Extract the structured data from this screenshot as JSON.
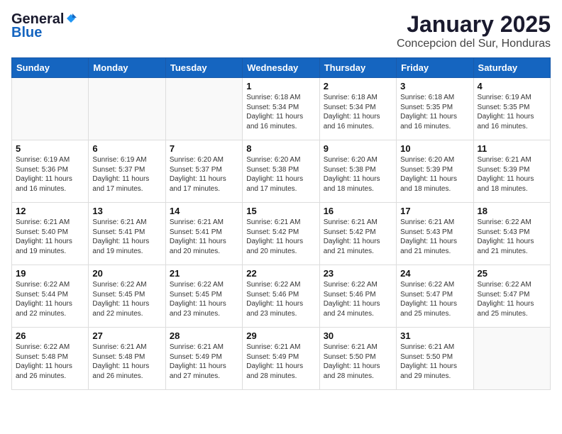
{
  "header": {
    "logo_general": "General",
    "logo_blue": "Blue",
    "title": "January 2025",
    "subtitle": "Concepcion del Sur, Honduras"
  },
  "weekdays": [
    "Sunday",
    "Monday",
    "Tuesday",
    "Wednesday",
    "Thursday",
    "Friday",
    "Saturday"
  ],
  "weeks": [
    [
      {
        "day": "",
        "sunrise": "",
        "sunset": "",
        "daylight": ""
      },
      {
        "day": "",
        "sunrise": "",
        "sunset": "",
        "daylight": ""
      },
      {
        "day": "",
        "sunrise": "",
        "sunset": "",
        "daylight": ""
      },
      {
        "day": "1",
        "sunrise": "Sunrise: 6:18 AM",
        "sunset": "Sunset: 5:34 PM",
        "daylight": "Daylight: 11 hours and 16 minutes."
      },
      {
        "day": "2",
        "sunrise": "Sunrise: 6:18 AM",
        "sunset": "Sunset: 5:34 PM",
        "daylight": "Daylight: 11 hours and 16 minutes."
      },
      {
        "day": "3",
        "sunrise": "Sunrise: 6:18 AM",
        "sunset": "Sunset: 5:35 PM",
        "daylight": "Daylight: 11 hours and 16 minutes."
      },
      {
        "day": "4",
        "sunrise": "Sunrise: 6:19 AM",
        "sunset": "Sunset: 5:35 PM",
        "daylight": "Daylight: 11 hours and 16 minutes."
      }
    ],
    [
      {
        "day": "5",
        "sunrise": "Sunrise: 6:19 AM",
        "sunset": "Sunset: 5:36 PM",
        "daylight": "Daylight: 11 hours and 16 minutes."
      },
      {
        "day": "6",
        "sunrise": "Sunrise: 6:19 AM",
        "sunset": "Sunset: 5:37 PM",
        "daylight": "Daylight: 11 hours and 17 minutes."
      },
      {
        "day": "7",
        "sunrise": "Sunrise: 6:20 AM",
        "sunset": "Sunset: 5:37 PM",
        "daylight": "Daylight: 11 hours and 17 minutes."
      },
      {
        "day": "8",
        "sunrise": "Sunrise: 6:20 AM",
        "sunset": "Sunset: 5:38 PM",
        "daylight": "Daylight: 11 hours and 17 minutes."
      },
      {
        "day": "9",
        "sunrise": "Sunrise: 6:20 AM",
        "sunset": "Sunset: 5:38 PM",
        "daylight": "Daylight: 11 hours and 18 minutes."
      },
      {
        "day": "10",
        "sunrise": "Sunrise: 6:20 AM",
        "sunset": "Sunset: 5:39 PM",
        "daylight": "Daylight: 11 hours and 18 minutes."
      },
      {
        "day": "11",
        "sunrise": "Sunrise: 6:21 AM",
        "sunset": "Sunset: 5:39 PM",
        "daylight": "Daylight: 11 hours and 18 minutes."
      }
    ],
    [
      {
        "day": "12",
        "sunrise": "Sunrise: 6:21 AM",
        "sunset": "Sunset: 5:40 PM",
        "daylight": "Daylight: 11 hours and 19 minutes."
      },
      {
        "day": "13",
        "sunrise": "Sunrise: 6:21 AM",
        "sunset": "Sunset: 5:41 PM",
        "daylight": "Daylight: 11 hours and 19 minutes."
      },
      {
        "day": "14",
        "sunrise": "Sunrise: 6:21 AM",
        "sunset": "Sunset: 5:41 PM",
        "daylight": "Daylight: 11 hours and 20 minutes."
      },
      {
        "day": "15",
        "sunrise": "Sunrise: 6:21 AM",
        "sunset": "Sunset: 5:42 PM",
        "daylight": "Daylight: 11 hours and 20 minutes."
      },
      {
        "day": "16",
        "sunrise": "Sunrise: 6:21 AM",
        "sunset": "Sunset: 5:42 PM",
        "daylight": "Daylight: 11 hours and 21 minutes."
      },
      {
        "day": "17",
        "sunrise": "Sunrise: 6:21 AM",
        "sunset": "Sunset: 5:43 PM",
        "daylight": "Daylight: 11 hours and 21 minutes."
      },
      {
        "day": "18",
        "sunrise": "Sunrise: 6:22 AM",
        "sunset": "Sunset: 5:43 PM",
        "daylight": "Daylight: 11 hours and 21 minutes."
      }
    ],
    [
      {
        "day": "19",
        "sunrise": "Sunrise: 6:22 AM",
        "sunset": "Sunset: 5:44 PM",
        "daylight": "Daylight: 11 hours and 22 minutes."
      },
      {
        "day": "20",
        "sunrise": "Sunrise: 6:22 AM",
        "sunset": "Sunset: 5:45 PM",
        "daylight": "Daylight: 11 hours and 22 minutes."
      },
      {
        "day": "21",
        "sunrise": "Sunrise: 6:22 AM",
        "sunset": "Sunset: 5:45 PM",
        "daylight": "Daylight: 11 hours and 23 minutes."
      },
      {
        "day": "22",
        "sunrise": "Sunrise: 6:22 AM",
        "sunset": "Sunset: 5:46 PM",
        "daylight": "Daylight: 11 hours and 23 minutes."
      },
      {
        "day": "23",
        "sunrise": "Sunrise: 6:22 AM",
        "sunset": "Sunset: 5:46 PM",
        "daylight": "Daylight: 11 hours and 24 minutes."
      },
      {
        "day": "24",
        "sunrise": "Sunrise: 6:22 AM",
        "sunset": "Sunset: 5:47 PM",
        "daylight": "Daylight: 11 hours and 25 minutes."
      },
      {
        "day": "25",
        "sunrise": "Sunrise: 6:22 AM",
        "sunset": "Sunset: 5:47 PM",
        "daylight": "Daylight: 11 hours and 25 minutes."
      }
    ],
    [
      {
        "day": "26",
        "sunrise": "Sunrise: 6:22 AM",
        "sunset": "Sunset: 5:48 PM",
        "daylight": "Daylight: 11 hours and 26 minutes."
      },
      {
        "day": "27",
        "sunrise": "Sunrise: 6:21 AM",
        "sunset": "Sunset: 5:48 PM",
        "daylight": "Daylight: 11 hours and 26 minutes."
      },
      {
        "day": "28",
        "sunrise": "Sunrise: 6:21 AM",
        "sunset": "Sunset: 5:49 PM",
        "daylight": "Daylight: 11 hours and 27 minutes."
      },
      {
        "day": "29",
        "sunrise": "Sunrise: 6:21 AM",
        "sunset": "Sunset: 5:49 PM",
        "daylight": "Daylight: 11 hours and 28 minutes."
      },
      {
        "day": "30",
        "sunrise": "Sunrise: 6:21 AM",
        "sunset": "Sunset: 5:50 PM",
        "daylight": "Daylight: 11 hours and 28 minutes."
      },
      {
        "day": "31",
        "sunrise": "Sunrise: 6:21 AM",
        "sunset": "Sunset: 5:50 PM",
        "daylight": "Daylight: 11 hours and 29 minutes."
      },
      {
        "day": "",
        "sunrise": "",
        "sunset": "",
        "daylight": ""
      }
    ]
  ]
}
